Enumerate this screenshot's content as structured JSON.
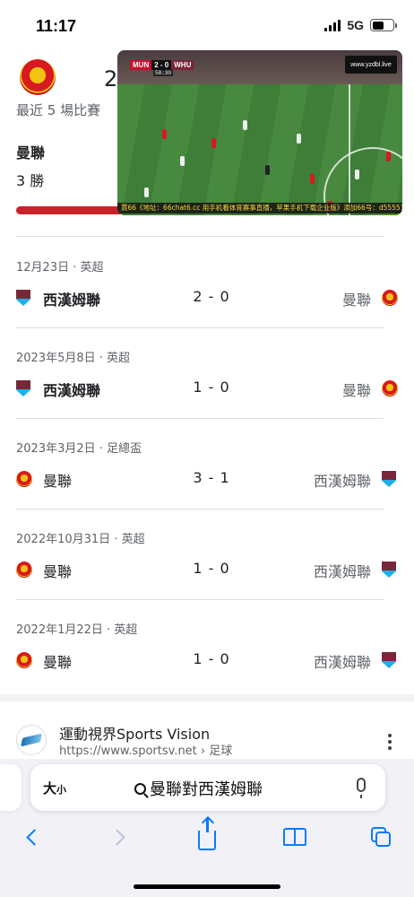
{
  "status_bar": {
    "time": "11:17",
    "network": "5G"
  },
  "summary": {
    "header_number": "2",
    "recent_label": "最近 5 場比賽",
    "team": "曼聯",
    "wins": "3 勝"
  },
  "video": {
    "home_abbr": "MUN",
    "score": "2 - 0",
    "away_abbr": "WHU",
    "clock": "58:30",
    "site_label": "www.yzdbl.live",
    "ticker": "賈66《地址：66chat6.cc 用手机看体育赛事直播，苹果手机下载企业版》添加66号：d55551 看专属推广"
  },
  "matches": [
    {
      "meta": "12月23日 · 英超",
      "home": "西漢姆聯",
      "home_crest": "west-ham",
      "score": "2 - 0",
      "away": "曼聯",
      "away_crest": "man-utd",
      "home_bold": true
    },
    {
      "meta": "2023年5月8日 · 英超",
      "home": "西漢姆聯",
      "home_crest": "west-ham",
      "score": "1 - 0",
      "away": "曼聯",
      "away_crest": "man-utd",
      "home_bold": true
    },
    {
      "meta": "2023年3月2日 · 足總盃",
      "home": "曼聯",
      "home_crest": "man-utd",
      "score": "3 - 1",
      "away": "西漢姆聯",
      "away_crest": "west-ham",
      "home_bold": false
    },
    {
      "meta": "2022年10月31日 · 英超",
      "home": "曼聯",
      "home_crest": "man-utd",
      "score": "1 - 0",
      "away": "西漢姆聯",
      "away_crest": "west-ham",
      "home_bold": false
    },
    {
      "meta": "2022年1月22日 · 英超",
      "home": "曼聯",
      "home_crest": "man-utd",
      "score": "1 - 0",
      "away": "西漢姆聯",
      "away_crest": "west-ham",
      "home_bold": false
    }
  ],
  "result": {
    "title": "運動視界Sports Vision",
    "url": "https://www.sportsv.net › 足球"
  },
  "address_bar": {
    "text_size_label": "大",
    "text_size_small": "小",
    "query": "曼聯對西漢姆聯"
  },
  "colors": {
    "accent": "#0a7aff",
    "man_utd_red": "#d81920",
    "west_ham_claret": "#7a263a"
  }
}
